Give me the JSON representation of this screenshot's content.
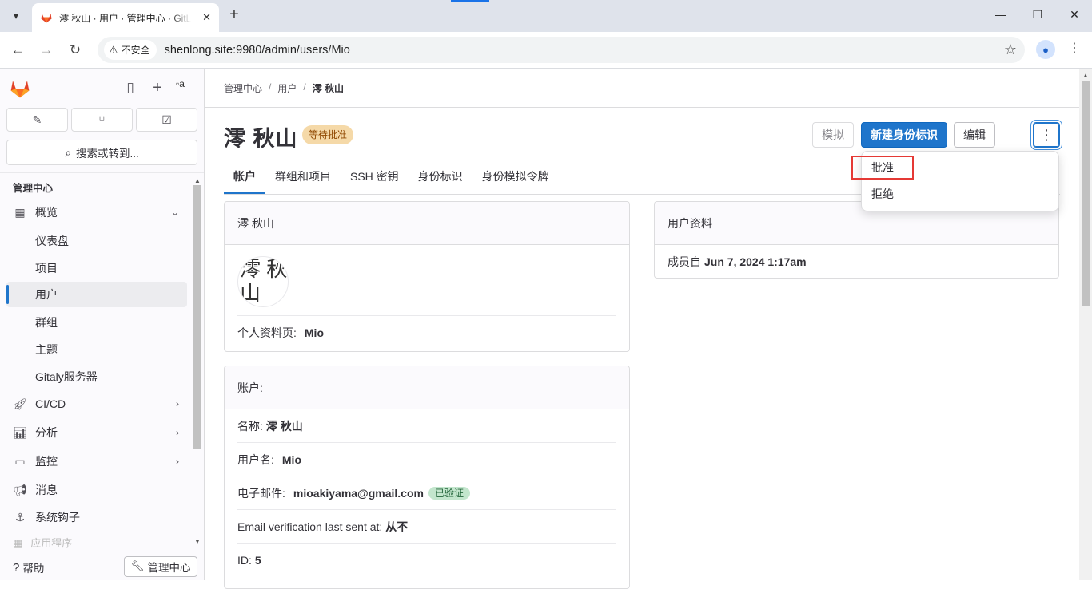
{
  "browser": {
    "tab_title": "澪 秋山 · 用户 · 管理中心 · GitLab",
    "new_tab": "+",
    "security_label": "不安全",
    "url": "shenlong.site:9980/admin/users/Mio",
    "minimize": "—",
    "restore": "❐",
    "close": "✕"
  },
  "sidebar": {
    "avatar_alt": "a",
    "search_label": "搜索或转到...",
    "section_title": "管理中心",
    "items": [
      {
        "label": "概览"
      },
      {
        "label": "仪表盘"
      },
      {
        "label": "项目"
      },
      {
        "label": "用户"
      },
      {
        "label": "群组"
      },
      {
        "label": "主题"
      },
      {
        "label": "Gitaly服务器"
      },
      {
        "label": "CI/CD"
      },
      {
        "label": "分析"
      },
      {
        "label": "监控"
      },
      {
        "label": "消息"
      },
      {
        "label": "系统钩子"
      },
      {
        "label": "应用程序"
      }
    ],
    "help_label": "帮助",
    "admin_button": "管理中心"
  },
  "breadcrumb": [
    "管理中心",
    "用户",
    "澪 秋山"
  ],
  "page": {
    "title": "澪 秋山",
    "status_badge": "等待批准",
    "buttons": {
      "impersonate": "模拟",
      "new_identity": "新建身份标识",
      "edit": "编辑",
      "more": "⋮"
    },
    "tabs": [
      "帐户",
      "群组和项目",
      "SSH 密钥",
      "身份标识",
      "身份模拟令牌"
    ],
    "dropdown": [
      "批准",
      "拒绝"
    ]
  },
  "profile_card": {
    "header": "澪 秋山",
    "avatar_alt": "澪 秋山",
    "profile_label": "个人资料页:",
    "profile_value": "Mio"
  },
  "user_info_card": {
    "header": "用户资料",
    "member_since_label": "成员自",
    "member_since_value": "Jun 7, 2024 1:17am"
  },
  "account_card": {
    "header": "账户:",
    "rows": [
      {
        "label": "名称:",
        "value": "澪 秋山"
      },
      {
        "label": "用户名:",
        "value": "Mio"
      },
      {
        "label": "电子邮件:",
        "value": "mioakiyama@gmail.com",
        "badge": "已验证"
      },
      {
        "label": "Email verification last sent at:",
        "value": "从不"
      },
      {
        "label": "ID:",
        "value": "5"
      }
    ]
  },
  "colors": {
    "accent": "#1f75cb",
    "pending_badge_bg": "#f5d9a8",
    "verified_badge_bg": "#c3e6cd",
    "highlight": "#e53935"
  }
}
